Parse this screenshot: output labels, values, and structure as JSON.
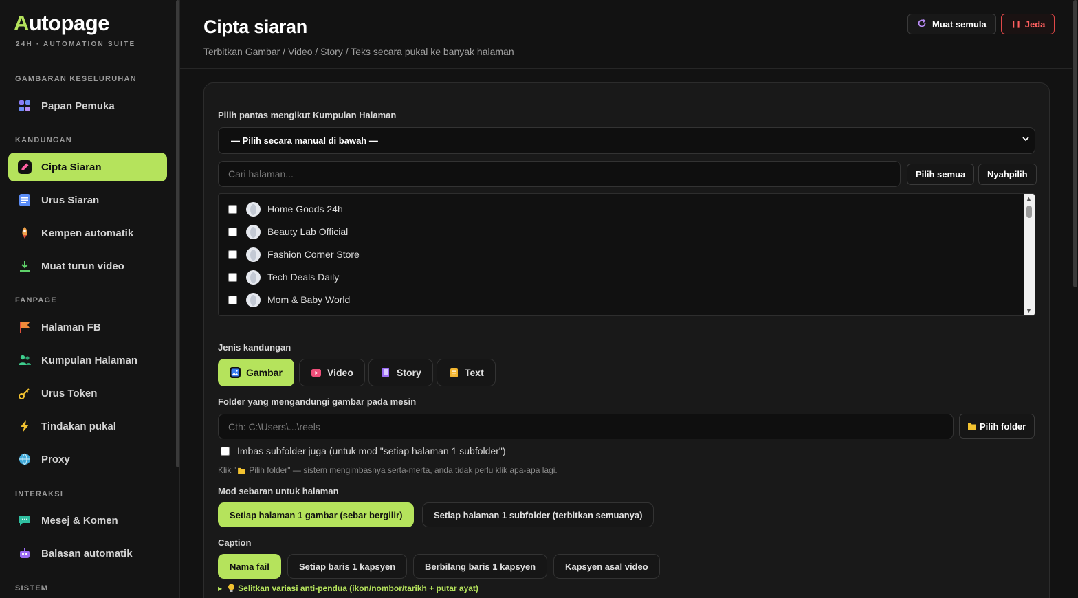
{
  "sidebar": {
    "logo": "Autopage",
    "tagline": "24H · AUTOMATION SUITE",
    "sections": {
      "overview": "GAMBARAN KESELURUHAN",
      "content": "KANDUNGAN",
      "fanpage": "FANPAGE",
      "interaction": "INTERAKSI",
      "system": "SISTEM"
    },
    "items": {
      "dashboard": "Papan Pemuka",
      "create_post": "Cipta Siaran",
      "manage_post": "Urus Siaran",
      "auto_campaign": "Kempen automatik",
      "download_video": "Muat turun video",
      "fb_pages": "Halaman FB",
      "page_groups": "Kumpulan Halaman",
      "tokens": "Urus Token",
      "bulk_actions": "Tindakan pukal",
      "proxy": "Proxy",
      "messages": "Mesej & Komen",
      "auto_reply": "Balasan automatik"
    }
  },
  "header": {
    "title": "Cipta siaran",
    "subtitle": "Terbitkan Gambar / Video / Story / Teks secara pukal ke banyak halaman",
    "reload_label": "Muat semula",
    "pause_label": "Jeda"
  },
  "form": {
    "group_label": "Pilih pantas mengikut Kumpulan Halaman",
    "group_select_value": "— Pilih secara manual di bawah —",
    "search_placeholder": "Cari halaman...",
    "select_all": "Pilih semua",
    "deselect": "Nyahpilih",
    "pages": [
      "Home Goods 24h",
      "Beauty Lab Official",
      "Fashion Corner Store",
      "Tech Deals Daily",
      "Mom & Baby World"
    ],
    "content_type_label": "Jenis kandungan",
    "content_types": {
      "image": "Gambar",
      "video": "Video",
      "story": "Story",
      "text": "Text"
    },
    "folder_label": "Folder yang mengandungi gambar pada mesin",
    "folder_placeholder": "Cth: C:\\Users\\...\\reels",
    "pick_folder": "Pilih folder",
    "scan_subfolders": "Imbas subfolder juga (untuk mod \"setiap halaman 1 subfolder\")",
    "hint_prefix": "Klik \"",
    "hint_suffix": " Pilih folder\" — sistem mengimbasnya serta-merta, anda tidak perlu klik apa-apa lagi.",
    "mode_label": "Mod sebaran untuk halaman",
    "modes": {
      "rotate": "Setiap halaman 1 gambar (sebar bergilir)",
      "subfolder": "Setiap halaman 1 subfolder (terbitkan semuanya)"
    },
    "caption_label": "Caption",
    "captions": {
      "filename": "Nama fail",
      "per_line": "Setiap baris 1 kapsyen",
      "multi_line": "Berbilang baris 1 kapsyen",
      "original": "Kapsyen asal video"
    },
    "anti_spam_tip": "Selitkan variasi anti-pendua (ikon/nombor/tarikh + putar ayat)"
  },
  "colors": {
    "accent": "#b5e35c",
    "danger": "#ff6060",
    "background": "#121212"
  }
}
